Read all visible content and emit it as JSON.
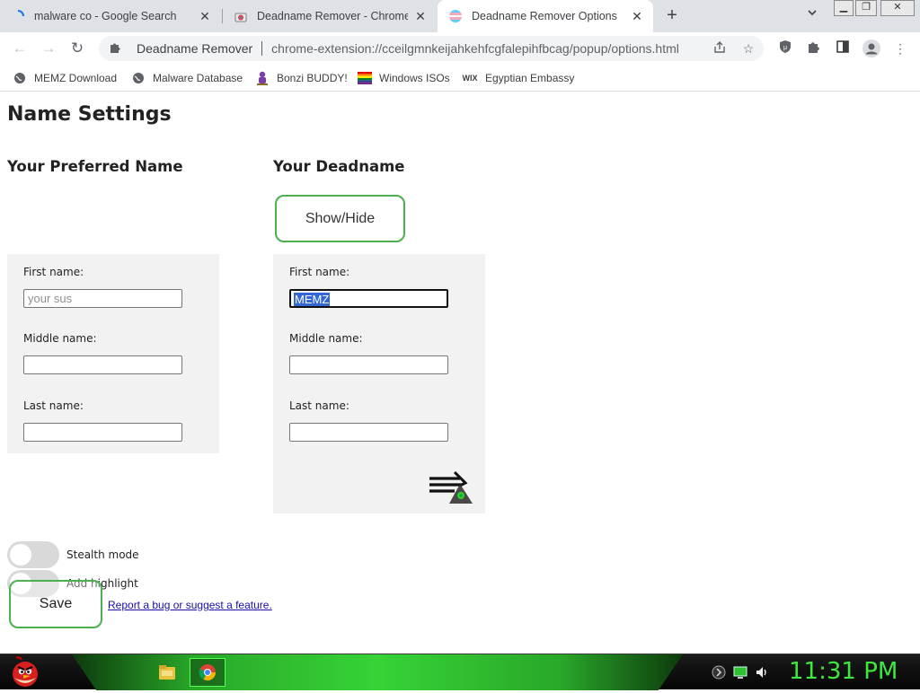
{
  "browser": {
    "tabs": [
      {
        "title": "malware co - Google Search",
        "icon": "loading-spinner-icon"
      },
      {
        "title": "Deadname Remover - Chrome W",
        "icon": "chrome-web-store-icon"
      },
      {
        "title": "Deadname Remover Options",
        "icon": "trans-flag-icon",
        "active": true
      }
    ],
    "window_controls": {
      "minimize": "▁",
      "restore": "❐",
      "close": "✕"
    },
    "omnibox": {
      "site_name": "Deadname Remover",
      "url": "chrome-extension://cceilgmnkeijahkehfcgfalepihfbcag/popup/options.html"
    },
    "bookmarks": [
      {
        "label": "MEMZ Download",
        "icon": "globe-icon"
      },
      {
        "label": "Malware Database",
        "icon": "globe-icon"
      },
      {
        "label": "Bonzi BUDDY!",
        "icon": "bonzi-icon"
      },
      {
        "label": "Windows ISOs",
        "icon": "rainbow-flag-icon"
      },
      {
        "label": "Egyptian Embassy",
        "icon": "wix-icon"
      }
    ]
  },
  "page": {
    "title": "Name Settings",
    "preferred": {
      "heading": "Your Preferred Name",
      "first_label": "First name:",
      "first_placeholder": "your sus",
      "middle_label": "Middle name:",
      "last_label": "Last name:"
    },
    "deadname": {
      "heading": "Your Deadname",
      "show_hide_label": "Show/Hide",
      "first_label": "First name:",
      "first_value": "MEMZ",
      "middle_label": "Middle name:",
      "last_label": "Last name:"
    },
    "toggles": {
      "stealth_label": "Stealth mode",
      "highlight_label": "Add highlight",
      "stealth_on": false,
      "highlight_on": false
    },
    "save_label": "Save",
    "report_link": "Report a bug or suggest a feature."
  },
  "taskbar": {
    "clock": "11:31 PM",
    "accent": "#3ee83e"
  }
}
